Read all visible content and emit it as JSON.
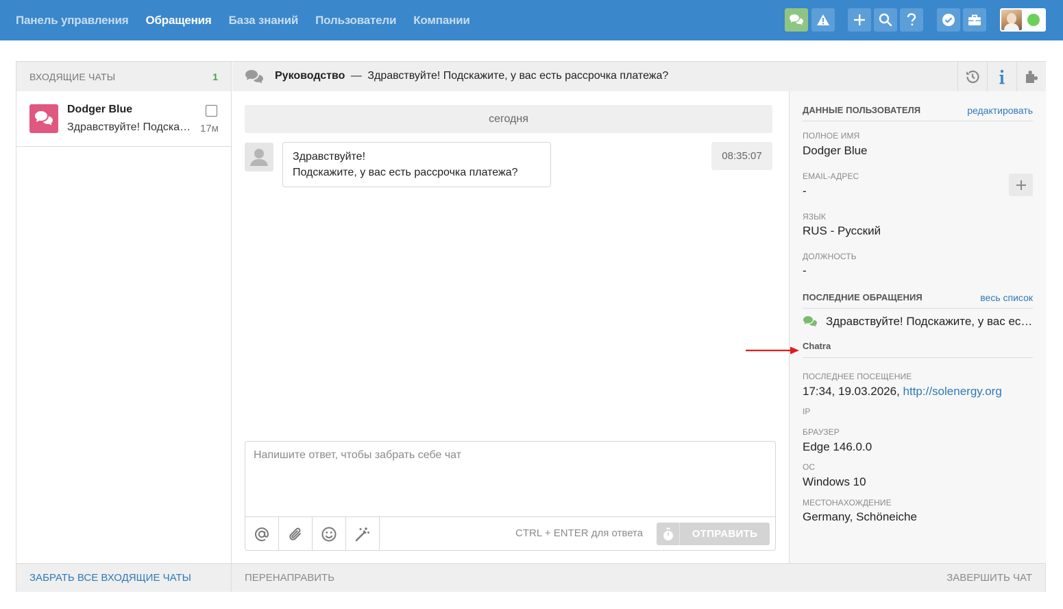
{
  "nav": {
    "items": [
      "Панель управления",
      "Обращения",
      "База знаний",
      "Пользователи",
      "Компании"
    ],
    "active_index": 1
  },
  "toolbar_icons": [
    "chats-icon",
    "warning-icon",
    "plus-icon",
    "search-icon",
    "help-icon",
    "check-badge-icon",
    "briefcase-icon"
  ],
  "user_status": "online",
  "inbox": {
    "title": "ВХОДЯЩИЕ ЧАТЫ",
    "count": "1",
    "chats": [
      {
        "name": "Dodger Blue",
        "preview": "Здравствуйте! Подскажите, у вас есть рассрочка платежа?",
        "time": "17м"
      }
    ]
  },
  "conversation": {
    "title_bold": "Руководство",
    "separator": "—",
    "subject": "Здравствуйте! Подскажите, у вас есть рассрочка платежа?",
    "day_label": "сегодня",
    "messages": [
      {
        "line1": "Здравствуйте!",
        "line2": "Подскажите, у вас есть рассрочка платежа?",
        "time": "08:35:07"
      }
    ]
  },
  "composer": {
    "placeholder": "Напишите ответ, чтобы забрать себе чат",
    "hint": "CTRL + ENTER для ответа",
    "send_label": "ОТПРАВИТЬ"
  },
  "user_panel": {
    "section_title": "ДАННЫЕ ПОЛЬЗОВАТЕЛЯ",
    "edit_link": "редактировать",
    "full_name_label": "ПОЛНОЕ ИМЯ",
    "full_name": "Dodger Blue",
    "email_label": "EMAIL-АДРЕС",
    "email": "-",
    "language_label": "ЯЗЫК",
    "language": "RUS - Русский",
    "position_label": "ДОЛЖНОСТЬ",
    "position": "-",
    "recent_title": "ПОСЛЕДНИЕ ОБРАЩЕНИЯ",
    "all_link": "весь список",
    "recent_item": "Здравствуйте! Подскажите, у вас есть рассрочка платежа?",
    "source_label": "Chatra",
    "last_visit_label": "ПОСЛЕДНЕЕ ПОСЕЩЕНИЕ",
    "last_visit_time": "17:34, 19.03.2026,",
    "last_visit_url": "http://solenergy.org",
    "ip_label": "IP",
    "browser_label": "БРАУЗЕР",
    "browser": "Edge 146.0.0",
    "os_label": "ОС",
    "os": "Windows 10",
    "location_label": "МЕСТОНАХОЖДЕНИЕ",
    "location": "Germany, Schöneiche"
  },
  "footer": {
    "take_all": "ЗАБРАТЬ ВСЕ ВХОДЯЩИЕ ЧАТЫ",
    "forward": "ПЕРЕНАПРАВИТЬ",
    "end_chat": "ЗАВЕРШИТЬ ЧАТ"
  },
  "colors": {
    "topbar": "#3a87cc",
    "accent_link": "#2e79b9",
    "chat_icon_bg": "#e0577f",
    "online": "#6bd05b",
    "annotation_arrow": "#e31b1b"
  }
}
